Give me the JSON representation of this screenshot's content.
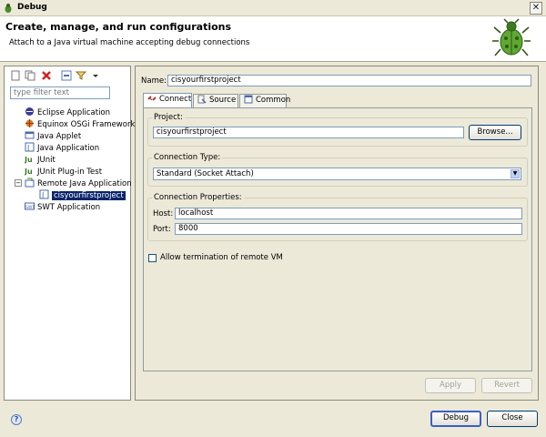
{
  "window": {
    "title": "Debug",
    "close_glyph": "✕"
  },
  "banner": {
    "heading": "Create, manage, and run configurations",
    "subheading": "Attach to a Java virtual machine accepting debug connections",
    "icon": "debug-bug-icon"
  },
  "sidebar": {
    "filter_placeholder": "type filter text",
    "items": [
      {
        "label": "Eclipse Application",
        "icon": "eclipse-icon"
      },
      {
        "label": "Equinox OSGi Framework",
        "icon": "osgi-icon"
      },
      {
        "label": "Java Applet",
        "icon": "applet-icon"
      },
      {
        "label": "Java Application",
        "icon": "java-app-icon"
      },
      {
        "label": "JUnit",
        "icon": "junit-icon"
      },
      {
        "label": "JUnit Plug-in Test",
        "icon": "junit-plugin-icon"
      },
      {
        "label": "Remote Java Application",
        "icon": "remote-java-icon",
        "expanded": true,
        "children": [
          {
            "label": "cisyourfirstproject",
            "icon": "config-icon",
            "selected": true
          }
        ]
      },
      {
        "label": "SWT Application",
        "icon": "swt-icon"
      }
    ]
  },
  "config": {
    "name_label": "Name:",
    "name_value": "cisyourfirstproject",
    "tabs": [
      {
        "label": "Connect",
        "active": true,
        "icon": "connect-icon"
      },
      {
        "label": "Source",
        "active": false,
        "icon": "source-icon"
      },
      {
        "label": "Common",
        "active": false,
        "icon": "common-icon"
      }
    ],
    "project_group": "Project:",
    "project_value": "cisyourfirstproject",
    "browse_label": "Browse...",
    "connection_type_group": "Connection Type:",
    "connection_type_value": "Standard (Socket Attach)",
    "connection_props_group": "Connection Properties:",
    "host_label": "Host:",
    "host_value": "localhost",
    "port_label": "Port:",
    "port_value": "8000",
    "allow_termination_label": "Allow termination of remote VM",
    "allow_termination_checked": false,
    "apply_label": "Apply",
    "revert_label": "Revert"
  },
  "footer": {
    "help_glyph": "?",
    "debug_label": "Debug",
    "close_label": "Close"
  },
  "colors": {
    "selection": "#0a246a",
    "accent_border": "#7f9db9",
    "dialog_bg": "#ece9d8"
  }
}
